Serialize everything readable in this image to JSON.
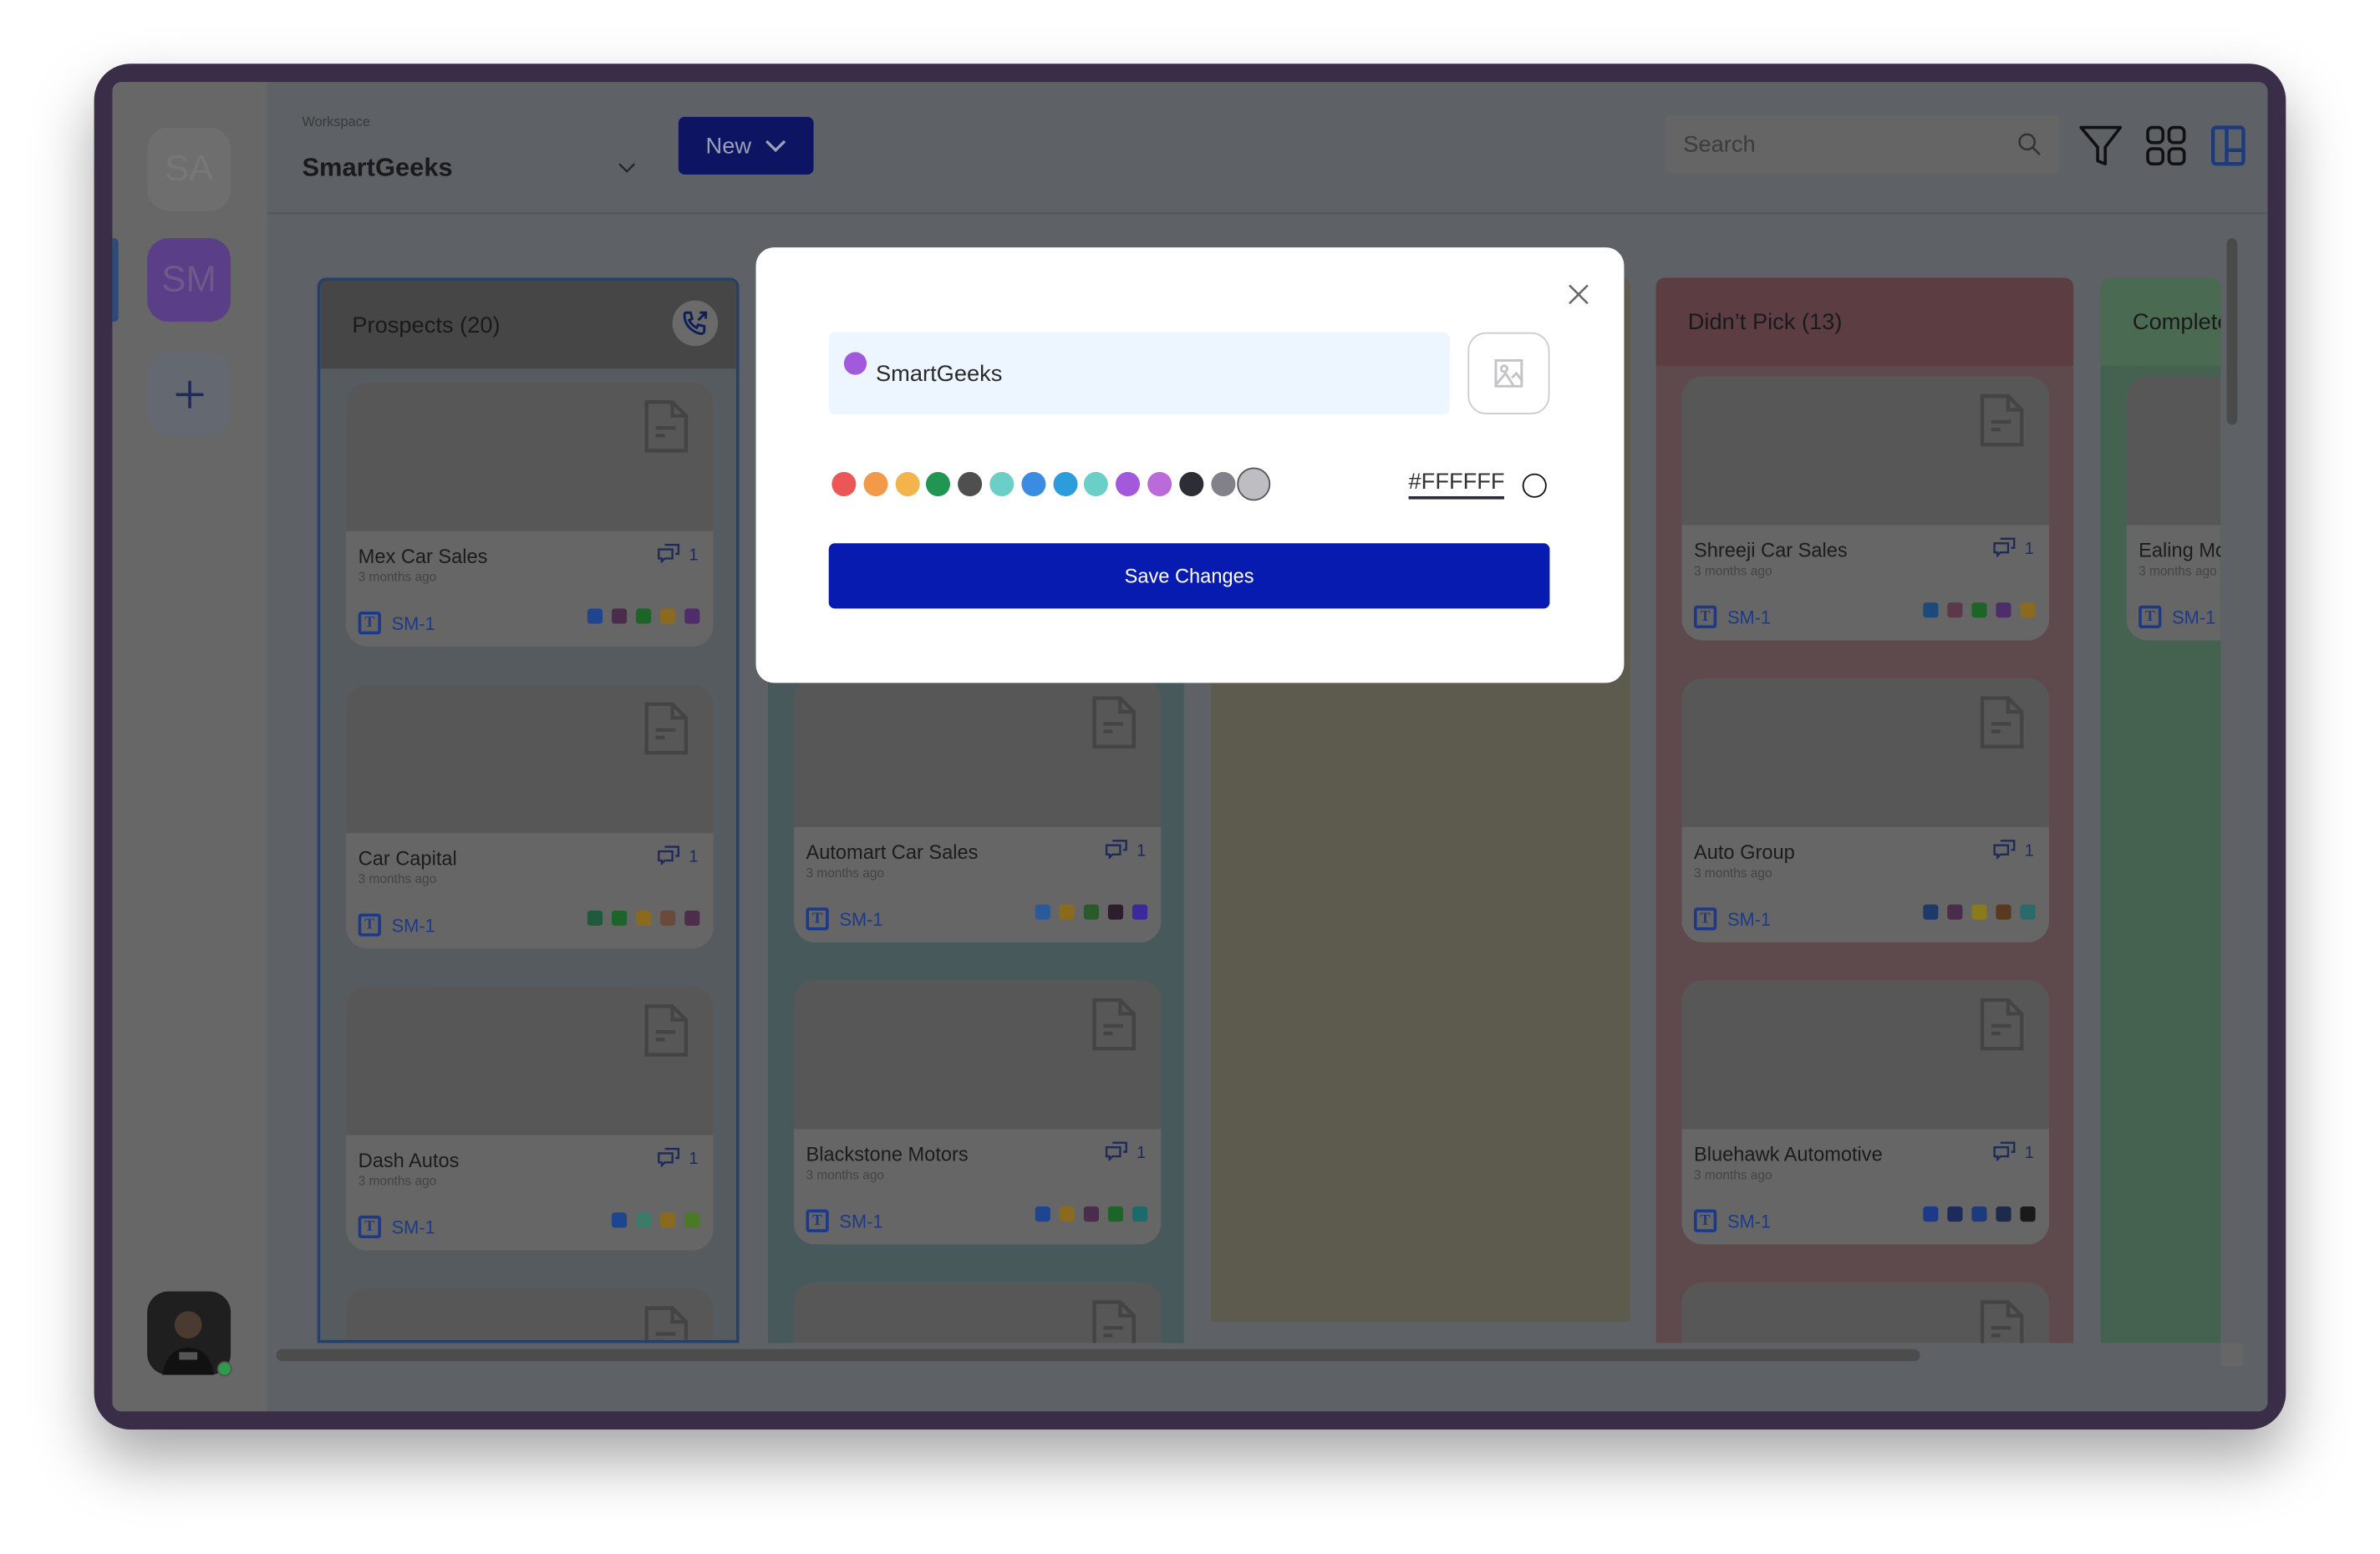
{
  "sidebar": {
    "workspaces": [
      {
        "initials": "SA",
        "color": "#6e6e6e"
      },
      {
        "initials": "SM",
        "color": "#5a3f88",
        "active": true
      }
    ],
    "add_icon": "plus-icon",
    "user_status": "online"
  },
  "header": {
    "workspace_label": "Workspace",
    "workspace_name": "SmartGeeks",
    "new_button": "New",
    "search_placeholder": "Search",
    "icons": [
      "filter-icon",
      "grid-view-icon",
      "kanban-view-icon"
    ]
  },
  "columns": [
    {
      "title": "Prospects (20)",
      "color": "#464646",
      "body": "#565b5f",
      "action_icon": "phone-outgoing-icon",
      "cards": [
        {
          "name": "Mex Car Sales",
          "time": "3 months ago",
          "comments": "1",
          "ticket": "SM-1",
          "tags": [
            "#1d4590",
            "#4a2d4a",
            "#1d6428",
            "#8a6a1e",
            "#4e2d6a"
          ]
        },
        {
          "name": "Car Capital",
          "time": "3 months ago",
          "comments": "1",
          "ticket": "SM-1",
          "tags": [
            "#1f5a3f",
            "#1d6428",
            "#8a6a1e",
            "#6a4a3a",
            "#4e2d4a"
          ]
        },
        {
          "name": "Dash Autos",
          "time": "3 months ago",
          "comments": "1",
          "ticket": "SM-1",
          "tags": [
            "#1d4590",
            "#3c7a6a",
            "#8a6a1e",
            "#4a7a28"
          ]
        },
        {
          "name": "",
          "time": "",
          "comments": "",
          "ticket": "",
          "tags": []
        }
      ]
    },
    {
      "title": "",
      "color": "#48595b",
      "body": "#48595b",
      "cards": [
        {
          "name": "",
          "time": "",
          "comments": "",
          "ticket": "",
          "tags": []
        },
        {
          "name": "Automart Car Sales",
          "time": "3 months ago",
          "comments": "1",
          "ticket": "SM-1",
          "tags": [
            "#2a5a9a",
            "#8a6a1e",
            "#2a5a2a",
            "#2d1d2d",
            "#3a2a9a"
          ]
        },
        {
          "name": "Blackstone Motors",
          "time": "3 months ago",
          "comments": "1",
          "ticket": "SM-1",
          "tags": [
            "#1d4590",
            "#8a6a1e",
            "#4a2d4a",
            "#1d6428",
            "#1d6a6a"
          ]
        },
        {
          "name": "",
          "time": "",
          "comments": "",
          "ticket": "",
          "tags": []
        }
      ]
    },
    {
      "title": "",
      "color": "#5d5b4e",
      "body": "#5d5b4e",
      "cards": []
    },
    {
      "title": "Didn’t Pick (13)",
      "color": "#5c3e42",
      "body": "#5e4a4d",
      "cards": [
        {
          "name": "Shreeji Car Sales",
          "time": "3 months ago",
          "comments": "1",
          "ticket": "SM-1",
          "tags": [
            "#1d4a7a",
            "#5a3a4a",
            "#1d6428",
            "#4e2d6a",
            "#8a6a1e"
          ]
        },
        {
          "name": "Auto Group",
          "time": "3 months ago",
          "comments": "1",
          "ticket": "SM-1",
          "tags": [
            "#1d3a6a",
            "#4a2d4a",
            "#8a7a1e",
            "#5a3a1e",
            "#2a6a6a"
          ]
        },
        {
          "name": "Bluehawk Automotive",
          "time": "3 months ago",
          "comments": "1",
          "ticket": "SM-1",
          "tags": [
            "#1d3a8a",
            "#1d2a5a",
            "#1d3a7a",
            "#1d2a4a",
            "#1a1a1a"
          ]
        },
        {
          "name": "",
          "time": "",
          "comments": "",
          "ticket": "",
          "tags": []
        }
      ]
    },
    {
      "title": "Complete",
      "color": "#4a6a52",
      "body": "#456150",
      "cards": [
        {
          "name": "Ealing Mo",
          "time": "3 months ago",
          "comments": "",
          "ticket": "SM-1",
          "tags": []
        }
      ]
    }
  ],
  "modal": {
    "name_value": "SmartGeeks",
    "selected_dot_color": "#a259db",
    "image_icon": "image-upload-icon",
    "swatches": [
      "#eb5757",
      "#f2994a",
      "#f2b44b",
      "#219653",
      "#4f4f4f",
      "#6bcfc8",
      "#3a8ce3",
      "#2d9cdb",
      "#6bcfc8",
      "#a259db",
      "#bb6bd9",
      "#2d2d36",
      "#828189",
      "#bdbdc2"
    ],
    "selected_swatch_index": 13,
    "hex_value": "#FFFFFF",
    "save_button": "Save Changes",
    "accent": "#071bb0"
  }
}
